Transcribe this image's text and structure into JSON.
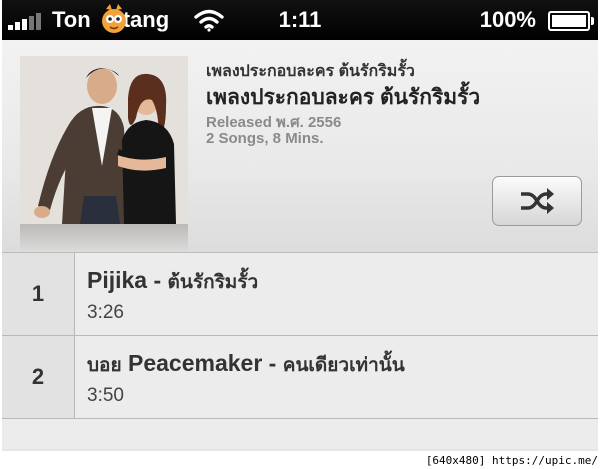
{
  "status_bar": {
    "carrier_left": "Ton",
    "carrier_right": "tang",
    "time": "1:11",
    "battery_percent": "100%",
    "signal_icon": "signal-bars-icon",
    "wifi_icon": "wifi-icon",
    "battery_icon": "battery-full-icon"
  },
  "album": {
    "artist": "เพลงประกอบละคร ต้นรักริมรั้ว",
    "title": "เพลงประกอบละคร ต้นรักริมรั้ว",
    "released": "Released พ.ศ. 2556",
    "summary": "2 Songs, 8 Mins.",
    "shuffle_icon": "shuffle-icon"
  },
  "tracks": [
    {
      "number": "1",
      "artist": "Pijika -",
      "song": "ต้นรักริมรั้ว",
      "duration": "3:26"
    },
    {
      "number": "2",
      "artist_prefix": "บอย",
      "artist": "Peacemaker -",
      "song": "คนเดียวเท่านั้น",
      "duration": "3:50"
    }
  ],
  "watermark": "[640x480] https://upic.me/"
}
